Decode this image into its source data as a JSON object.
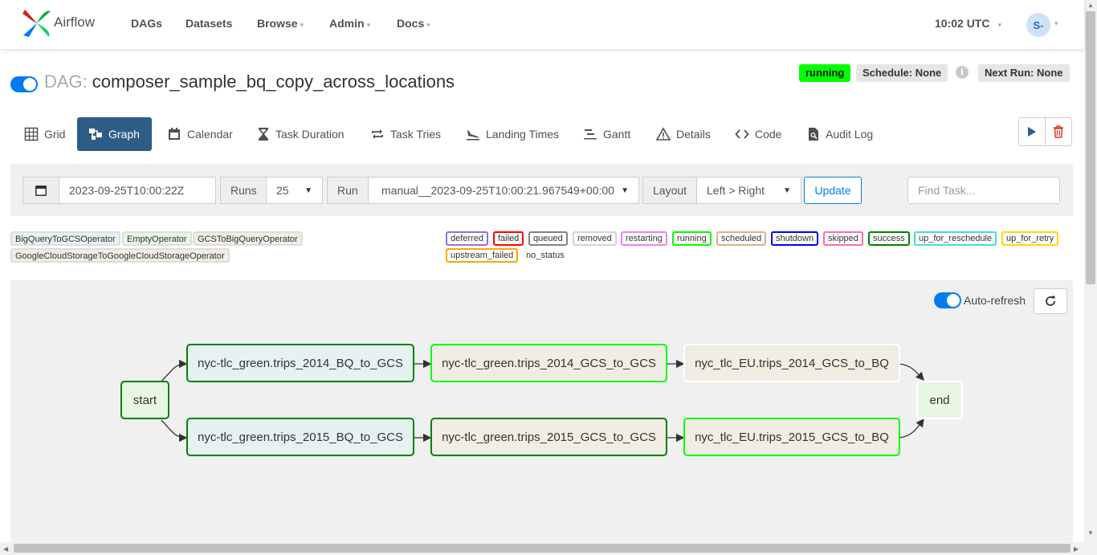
{
  "navbar": {
    "brand": "Airflow",
    "items": [
      {
        "label": "DAGs",
        "dropdown": false
      },
      {
        "label": "Datasets",
        "dropdown": false
      },
      {
        "label": "Browse",
        "dropdown": true
      },
      {
        "label": "Admin",
        "dropdown": true
      },
      {
        "label": "Docs",
        "dropdown": true
      }
    ],
    "time": "10:02 UTC",
    "user_initials": "S-"
  },
  "dag": {
    "prefix": "DAG:",
    "id": "composer_sample_bq_copy_across_locations",
    "paused": false,
    "state": "running",
    "schedule": "Schedule: None",
    "next_run": "Next Run: None"
  },
  "tabs": [
    {
      "label": "Grid",
      "icon": "grid-icon"
    },
    {
      "label": "Graph",
      "icon": "graph-icon",
      "active": true
    },
    {
      "label": "Calendar",
      "icon": "calendar-icon"
    },
    {
      "label": "Task Duration",
      "icon": "hourglass-icon"
    },
    {
      "label": "Task Tries",
      "icon": "repeat-icon"
    },
    {
      "label": "Landing Times",
      "icon": "plane-landing-icon"
    },
    {
      "label": "Gantt",
      "icon": "gantt-icon"
    },
    {
      "label": "Details",
      "icon": "warning-triangle-icon"
    },
    {
      "label": "Code",
      "icon": "code-icon"
    },
    {
      "label": "Audit Log",
      "icon": "search-file-icon"
    }
  ],
  "filters": {
    "base_date": "2023-09-25T10:00:22Z",
    "runs_label": "Runs",
    "runs_value": "25",
    "run_label": "Run",
    "run_value": "manual__2023-09-25T10:00:21.967549+00:00",
    "layout_label": "Layout",
    "layout_value": "Left > Right",
    "update_label": "Update",
    "find_task_placeholder": "Find Task..."
  },
  "operators": [
    {
      "name": "BigQueryToGCSOperator",
      "color": "#e6f1f2"
    },
    {
      "name": "EmptyOperator",
      "color": "#e8f7e4"
    },
    {
      "name": "GCSToBigQueryOperator",
      "color": "#f0ede4"
    },
    {
      "name": "GoogleCloudStorageToGoogleCloudStorageOperator",
      "color": "#f0ede4"
    }
  ],
  "states": [
    {
      "name": "deferred",
      "color": "#9370db"
    },
    {
      "name": "failed",
      "color": "#ff0000"
    },
    {
      "name": "queued",
      "color": "#808080"
    },
    {
      "name": "removed",
      "color": "#d3d3d3"
    },
    {
      "name": "restarting",
      "color": "#ee82ee"
    },
    {
      "name": "running",
      "color": "#00ff00"
    },
    {
      "name": "scheduled",
      "color": "#d2b48c"
    },
    {
      "name": "shutdown",
      "color": "#0000ff"
    },
    {
      "name": "skipped",
      "color": "#ff69b4"
    },
    {
      "name": "success",
      "color": "#008000"
    },
    {
      "name": "up_for_reschedule",
      "color": "#40e0d0"
    },
    {
      "name": "up_for_retry",
      "color": "#ffd700"
    },
    {
      "name": "upstream_failed",
      "color": "#ffa500"
    },
    {
      "name": "no_status",
      "color": ""
    }
  ],
  "graph": {
    "auto_refresh_label": "Auto-refresh",
    "auto_refresh": true,
    "nodes": {
      "start": {
        "label": "start",
        "state": "success",
        "fill": "#e8f7e4"
      },
      "bq2014": {
        "label": "nyc-tlc_green.trips_2014_BQ_to_GCS",
        "state": "success",
        "fill": "#e6f1f2"
      },
      "gcs2014": {
        "label": "nyc-tlc_green.trips_2014_GCS_to_GCS",
        "state": "running",
        "fill": "#f0ede4"
      },
      "eu2014": {
        "label": "nyc_tlc_EU.trips_2014_GCS_to_BQ",
        "state": "no_status",
        "fill": "#f0ede4"
      },
      "bq2015": {
        "label": "nyc-tlc_green.trips_2015_BQ_to_GCS",
        "state": "success",
        "fill": "#e6f1f2"
      },
      "gcs2015": {
        "label": "nyc-tlc_green.trips_2015_GCS_to_GCS",
        "state": "success",
        "fill": "#f0ede4"
      },
      "eu2015": {
        "label": "nyc_tlc_EU.trips_2015_GCS_to_BQ",
        "state": "running",
        "fill": "#f0ede4"
      },
      "end": {
        "label": "end",
        "state": "no_status",
        "fill": "#e8f7e4"
      }
    }
  }
}
